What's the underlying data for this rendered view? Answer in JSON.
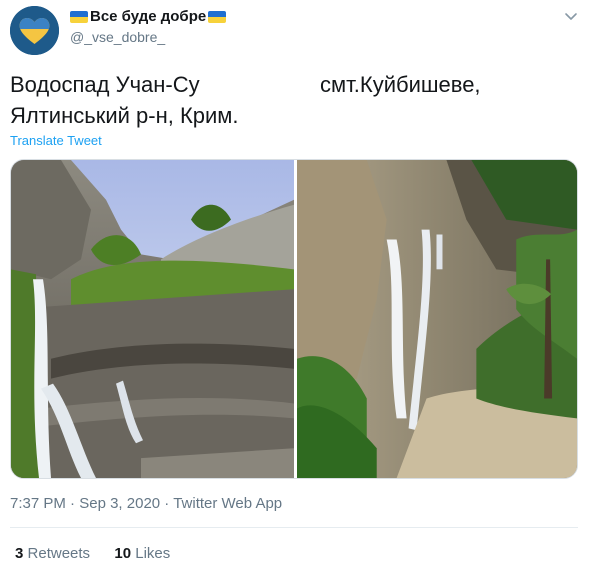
{
  "author": {
    "display_name": "Все буде добре",
    "handle": "@_vse_dobre_"
  },
  "tweet": {
    "line1_left": "Водоспад Учан-Су",
    "line1_right": "смт.Куйбишеве,",
    "line2": "Ялтинський р-н, Крим.",
    "translate_label": "Translate Tweet"
  },
  "meta": {
    "time": "7:37 PM",
    "sep1": "·",
    "date": "Sep 3, 2020",
    "sep2": "·",
    "source": "Twitter Web App"
  },
  "stats": {
    "retweets_count": "3",
    "retweets_label": "Retweets",
    "likes_count": "10",
    "likes_label": "Likes"
  },
  "colors": {
    "link": "#1da1f2",
    "secondary_text": "#657786",
    "flag_blue": "#1f6fd1",
    "flag_yellow": "#f7d23b"
  },
  "icons": [
    "heart-avatar-icon",
    "flag-icon",
    "chevron-down-icon"
  ]
}
